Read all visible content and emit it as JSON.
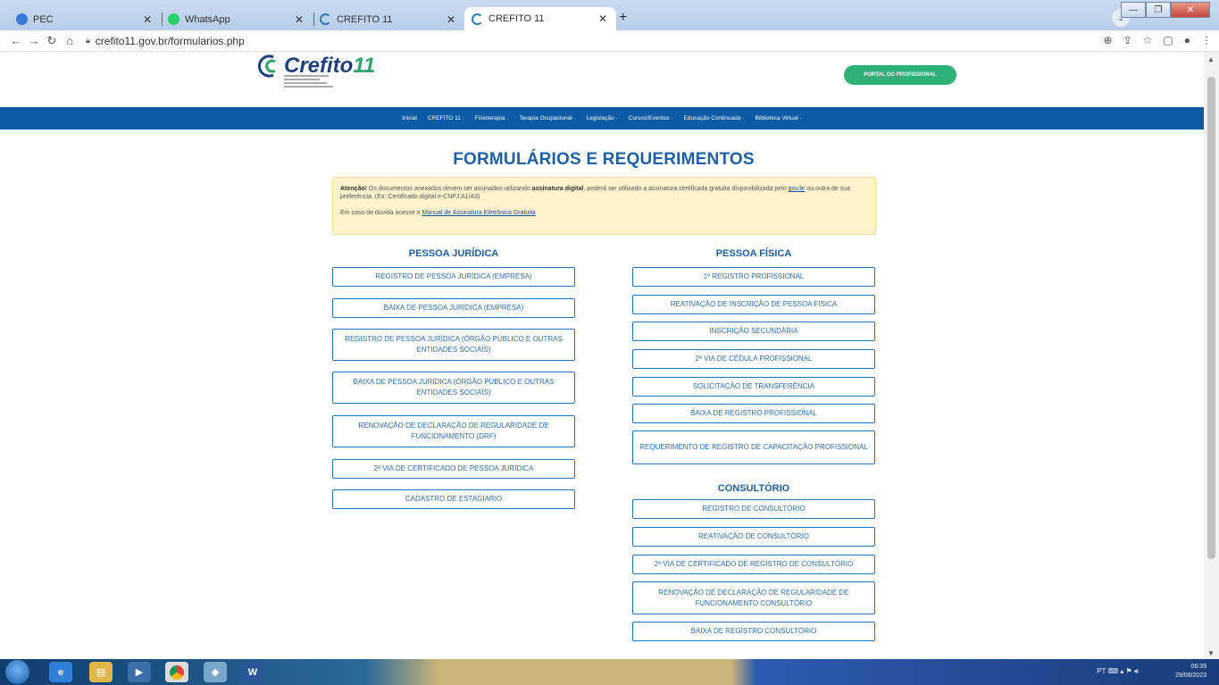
{
  "browser": {
    "tabs": [
      {
        "label": "PEC",
        "icon": "pec-icon",
        "color": "#3b78d8"
      },
      {
        "label": "WhatsApp",
        "icon": "whatsapp-icon",
        "color": "#25d366"
      },
      {
        "label": "CREFITO 11",
        "icon": "crefito-icon",
        "color": "#2a7fb8"
      },
      {
        "label": "CREFITO 11",
        "icon": "crefito-icon",
        "color": "#2a7fb8"
      }
    ],
    "url": "crefito11.gov.br/formularios.php"
  },
  "header": {
    "logo_text": "Crefito",
    "logo_num": "11",
    "portal_label": "PORTAL DO PROFISSIONAL",
    "nav": [
      "Inicial",
      "CREFITO 11 ·",
      "Fisioterapia ·",
      "Terapia Ocupacional ·",
      "Legislação ·",
      "Cursos/Eventos ·",
      "Educação Continuada ·",
      "Biblioteca Virtual ·"
    ]
  },
  "main": {
    "title": "FORMULÁRIOS E REQUERIMENTOS",
    "notice": {
      "attention": "Atenção!",
      "text1": " Os documentos anexados devem ser assinados utilizando ",
      "bold1": "assinatura digital",
      "text2": ", poderá ser utilizado a assinatura certificada gratuita disponibilizada pelo ",
      "link1": "gov.br",
      "text3": " ou outra de sua preferência. (Ex: Certificado digital e-CNPJ A1/A3)",
      "text4": "Em caso de dúvida acesse o ",
      "link2": "Manual de Assinatura Eletrônica Gratuita"
    },
    "pj_heading": "PESSOA JURÍDICA",
    "pj_items": [
      "REGISTRO DE PESSOA JURÍDICA (EMPRESA)",
      "BAIXA DE PESSOA JURÍDICA (EMPRESA)",
      "REGISTRO DE PESSOA JURÍDICA (ÓRGÃO PÚBLICO E OUTRAS ENTIDADES SOCIAIS)",
      "BAIXA DE PESSOA JURÍDICA (ÓRGÃO PÚBLICO E OUTRAS ENTIDADES SOCIAIS)",
      "RENOVAÇÃO DE DECLARAÇÃO DE REGULARIDADE DE FUNCIONAMENTO (DRF)",
      "2ª VIA DE CERTIFICADO DE PESSOA JURÍDICA",
      "CADASTRO DE ESTAGIARIO"
    ],
    "pf_heading": "PESSOA FÍSICA",
    "pf_items": [
      "1º REGISTRO PROFISSIONAL",
      "REATIVAÇÃO DE INSCRIÇÃO DE PESSOA FÍSICA",
      "INSCRIÇÃO SECUNDÁRIA",
      "2ª VIA DE CÉDULA PROFISSIONAL",
      "SOLICITAÇÃO DE TRANSFERÊNCIA",
      "BAIXA DE REGISTRO PROFISSIONAL",
      "REQUERIMENTO DE REGISTRO DE CAPACITAÇÃO PROFISSIONAL"
    ],
    "cons_heading": "CONSULTÓRIO",
    "cons_items": [
      "REGISTRO DE CONSULTÓRIO",
      "REATIVAÇÃO DE CONSULTÓRIO",
      "2ª VIA DE CERTIFICADO DE REGISTRO DE CONSULTÓRIO",
      "RENOVAÇÃO DE DECLARAÇÃO DE REGULARIDADE DE FUNCIONAMENTO CONSULTÓRIO",
      "BAIXA DE REGISTRO CONSULTÓRIO"
    ]
  },
  "taskbar": {
    "lang": "PT",
    "time": "06:39",
    "date": "29/08/2023"
  }
}
